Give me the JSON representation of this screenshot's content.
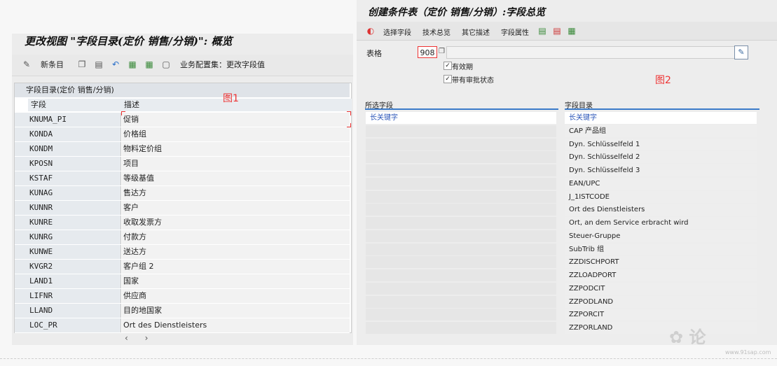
{
  "figure_labels": {
    "fig1": "图1",
    "fig2": "图2"
  },
  "left_panel": {
    "title": "更改视图 \"字段目录(定价 销售/分销)\": 概览",
    "toolbar": {
      "new_entries": "新条目",
      "config_set": "业务配置集：更改字段值",
      "icons": [
        "wand-icon",
        "copy-icon",
        "delete-icon",
        "undo-icon",
        "select-all-icon",
        "select-block-icon",
        "deselect-all-icon"
      ]
    },
    "table": {
      "title": "字段目录(定价 销售/分销)",
      "headers": [
        "字段",
        "描述"
      ],
      "rows": [
        [
          "KNUMA_PI",
          "促销"
        ],
        [
          "KONDA",
          "价格组"
        ],
        [
          "KONDM",
          "物料定价组"
        ],
        [
          "KPOSN",
          "项目"
        ],
        [
          "KSTAF",
          "等级基值"
        ],
        [
          "KUNAG",
          "售达方"
        ],
        [
          "KUNNR",
          "客户"
        ],
        [
          "KUNRE",
          "收取发票方"
        ],
        [
          "KUNRG",
          "付款方"
        ],
        [
          "KUNWE",
          "送达方"
        ],
        [
          "KVGR2",
          "客户组 2"
        ],
        [
          "LAND1",
          "国家"
        ],
        [
          "LIFNR",
          "供应商"
        ],
        [
          "LLAND",
          "目的地国家"
        ],
        [
          "LOC_PR",
          "Ort des Dienstleisters"
        ]
      ],
      "scroll": "‹  ›"
    }
  },
  "right_panel": {
    "title": "创建条件表（定价 销售/分销）:字段总览",
    "toolbar": [
      "选择字段",
      "技术总览",
      "其它描述",
      "字段属性"
    ],
    "table_label": "表格",
    "table_value": "908",
    "checkboxes": [
      {
        "label": "有效期",
        "checked": true
      },
      {
        "label": "带有审批状态",
        "checked": true
      }
    ],
    "selected_fields": {
      "header": "所选字段",
      "items": [
        "长关键字"
      ]
    },
    "field_catalog": {
      "header": "字段目录",
      "items": [
        "长关键字",
        "CAP 产品组",
        "Dyn. Schlüsselfeld 1",
        "Dyn. Schlüsselfeld 2",
        "Dyn. Schlüsselfeld 3",
        "EAN/UPC",
        "J_1ISTCODE",
        "Ort des Dienstleisters",
        "Ort, an dem Service erbracht wird",
        "Steuer-Gruppe",
        "SubTrib 组",
        "ZZDISCHPORT",
        "ZZLOADPORT",
        "ZZPODCIT",
        "ZZPODLAND",
        "ZZPORCIT",
        "ZZPORLAND"
      ]
    }
  },
  "watermark": {
    "text": "✿ 论",
    "url": "www.91sap.com"
  }
}
